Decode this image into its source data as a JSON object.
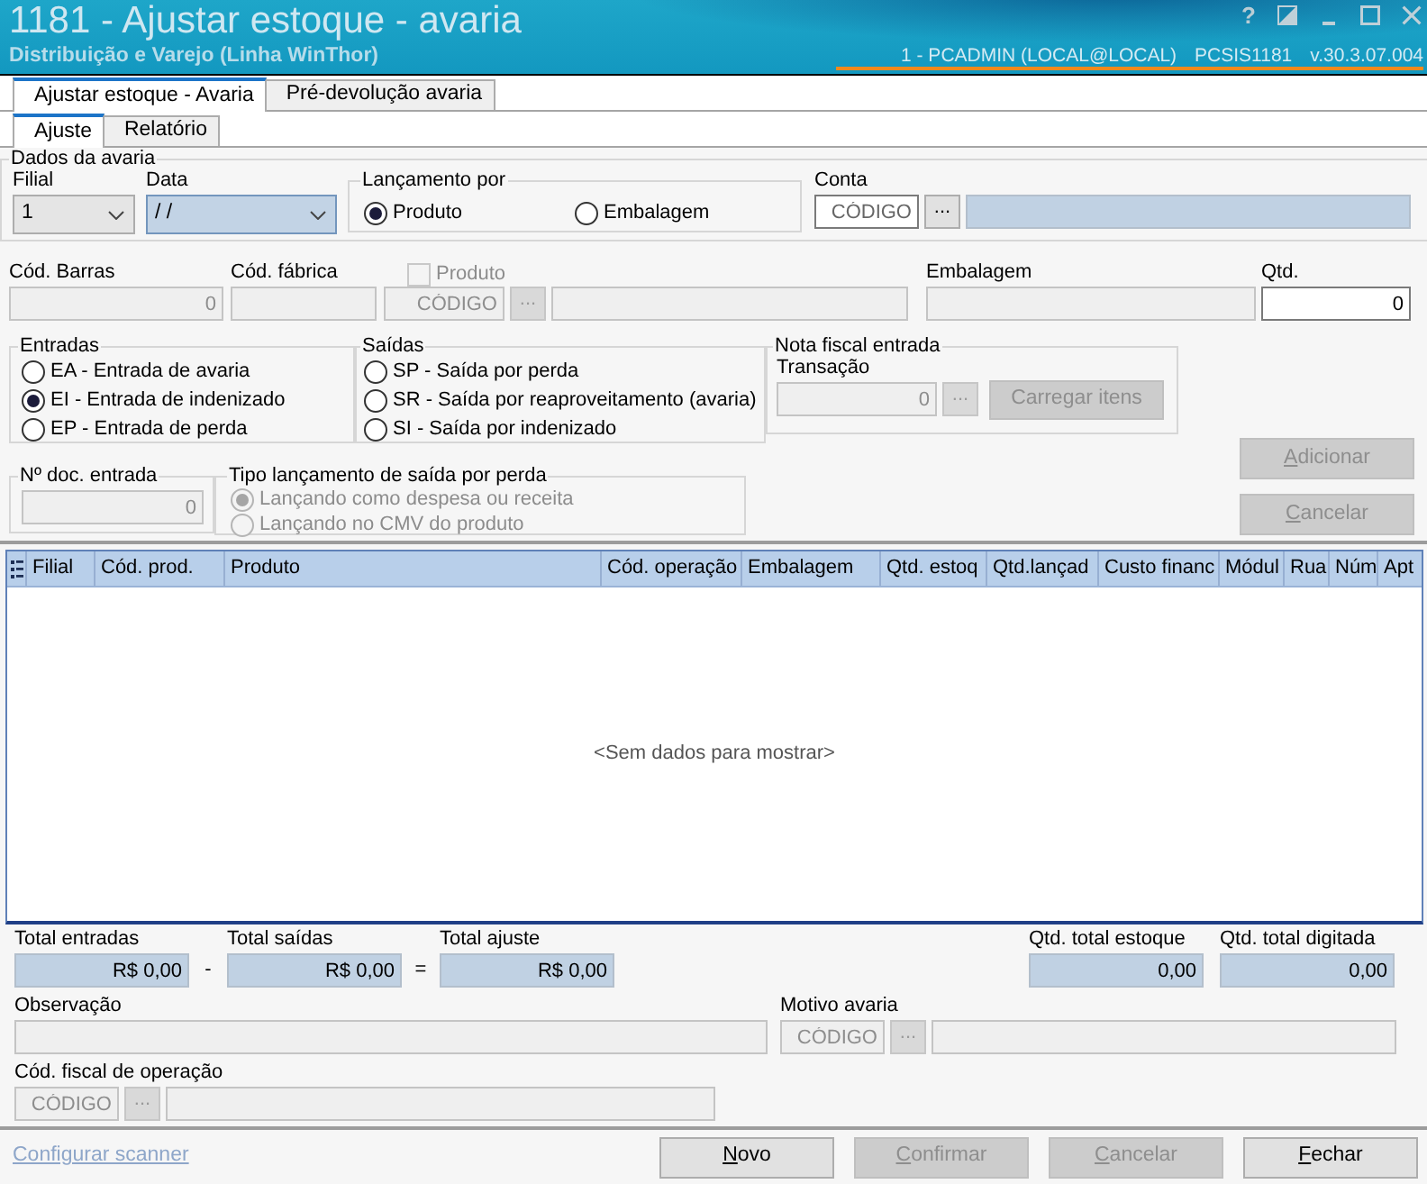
{
  "window": {
    "title": "1181 - Ajustar estoque - avaria",
    "subtitle": "Distribuição e Varejo (Linha WinThor)",
    "help": "?",
    "session": "1 - PCADMIN (LOCAL@LOCAL)",
    "program": "PCSIS1181",
    "version": "v.30.3.07.004"
  },
  "tabs": [
    {
      "label": "Ajustar estoque - Avaria",
      "selected": true
    },
    {
      "label": "Pré-devolução avaria",
      "selected": false
    }
  ],
  "subtabs": [
    {
      "label": "Ajuste",
      "selected": true
    },
    {
      "label": "Relatório",
      "selected": false
    }
  ],
  "dados_avaria": {
    "title": "Dados da avaria",
    "filial": {
      "label": "Filial",
      "value": "1"
    },
    "data": {
      "label": "Data",
      "value": "/ /",
      "readonly": true
    },
    "lancamento_por": {
      "title": "Lançamento por",
      "options": [
        {
          "label": "Produto",
          "selected": true
        },
        {
          "label": "Embalagem",
          "selected": false
        }
      ]
    },
    "conta": {
      "label": "Conta",
      "code": {
        "placeholder": "CÓDIGO",
        "disabled": false
      },
      "lookup": {
        "label": "...",
        "disabled": false
      },
      "description": {
        "readonly": true
      }
    }
  },
  "produto_linha": {
    "cod_barras": {
      "label": "Cód. Barras",
      "value": "0",
      "disabled": true
    },
    "cod_fabrica": {
      "label": "Cód. fábrica",
      "disabled": true
    },
    "produto": {
      "label": "Produto",
      "checked": false,
      "disabled": true,
      "code": {
        "placeholder": "CÓDIGO",
        "disabled": true
      },
      "lookup": {
        "label": "...",
        "disabled": true
      },
      "description": {
        "disabled": true
      }
    },
    "embalagem": {
      "label": "Embalagem",
      "disabled": true
    },
    "qtd": {
      "label": "Qtd.",
      "value": "0",
      "disabled": false
    }
  },
  "entradas": {
    "title": "Entradas",
    "options": [
      {
        "label": "EA - Entrada de avaria",
        "selected": false
      },
      {
        "label": "EI - Entrada de indenizado",
        "selected": true
      },
      {
        "label": "EP - Entrada de perda",
        "selected": false
      }
    ]
  },
  "saidas": {
    "title": "Saídas",
    "options": [
      {
        "label": "SP - Saída por perda",
        "selected": false
      },
      {
        "label": "SR - Saída por reaproveitamento (avaria)",
        "selected": false
      },
      {
        "label": "SI - Saída por indenizado",
        "selected": false
      }
    ]
  },
  "nota_fiscal": {
    "title": "Nota fiscal entrada",
    "transacao": {
      "label": "Transação",
      "value": "0",
      "disabled": true
    },
    "lookup": {
      "label": "...",
      "disabled": true
    },
    "carregar": {
      "label": "Carregar itens",
      "disabled": true
    }
  },
  "doc_entrada": {
    "title": "Nº doc. entrada",
    "value": "0",
    "disabled": true
  },
  "tipo_lancamento": {
    "title": "Tipo lançamento de saída por perda",
    "disabled": true,
    "options": [
      {
        "label": "Lançando como despesa ou receita",
        "selected": true
      },
      {
        "label": "Lançando no CMV do produto",
        "selected": false
      }
    ]
  },
  "actions": [
    {
      "label": "Adicionar",
      "disabled": true
    },
    {
      "label": "Cancelar",
      "disabled": true
    }
  ],
  "table": {
    "columns": [
      "Filial",
      "Cód. prod.",
      "Produto",
      "Cód. operação",
      "Embalagem",
      "Qtd. estoq",
      "Qtd.lançad",
      "Custo financ",
      "Módul",
      "Rua",
      "Núm",
      "Apt"
    ],
    "empty_text": "<Sem dados para mostrar>"
  },
  "totals": [
    {
      "kind": "total",
      "label": "Total entradas",
      "value": "R$ 0,00"
    },
    {
      "kind": "operator",
      "text": "-"
    },
    {
      "kind": "total",
      "label": "Total saídas",
      "value": "R$ 0,00"
    },
    {
      "kind": "operator",
      "text": "="
    },
    {
      "kind": "total",
      "label": "Total ajuste",
      "value": "R$ 0,00"
    }
  ],
  "quantities": [
    {
      "label": "Qtd. total estoque",
      "value": "0,00"
    },
    {
      "label": "Qtd. total digitada",
      "value": "0,00"
    }
  ],
  "observacao": {
    "label": "Observação",
    "disabled": true
  },
  "motivo_avaria": {
    "label": "Motivo avaria",
    "code": {
      "placeholder": "CÓDIGO",
      "disabled": true
    },
    "lookup": {
      "label": "...",
      "disabled": true
    },
    "description": {
      "disabled": true
    }
  },
  "cfop": {
    "label": "Cód. fiscal de operação",
    "code": {
      "placeholder": "CÓDIGO",
      "disabled": true
    },
    "lookup": {
      "label": "...",
      "disabled": true
    },
    "description": {
      "disabled": true
    }
  },
  "footer": {
    "link": "Configurar scanner",
    "buttons": [
      {
        "label": "Novo",
        "disabled": false
      },
      {
        "label": "Confirmar",
        "disabled": true
      },
      {
        "label": "Cancelar",
        "disabled": true
      },
      {
        "label": "Fechar",
        "disabled": false
      }
    ]
  }
}
